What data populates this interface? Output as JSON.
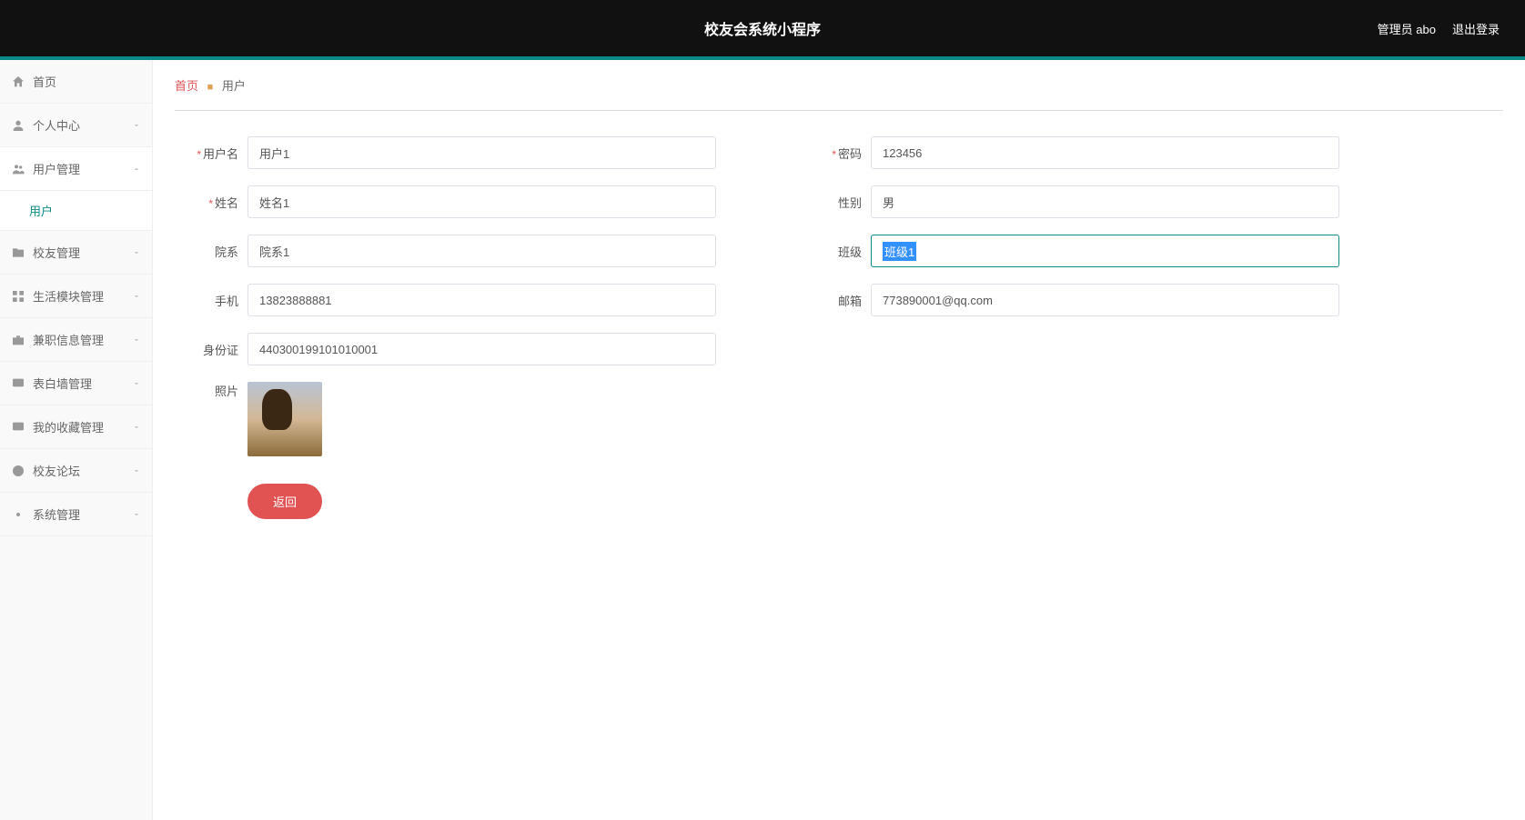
{
  "header": {
    "title": "校友会系统小程序",
    "admin": "管理员 abo",
    "logout": "退出登录"
  },
  "sidebar": {
    "items": [
      {
        "label": "首页",
        "icon": "home"
      },
      {
        "label": "个人中心",
        "icon": "user",
        "chev": true
      },
      {
        "label": "用户管理",
        "icon": "users",
        "chev": true,
        "expanded": true,
        "children": [
          {
            "label": "用户"
          }
        ]
      },
      {
        "label": "校友管理",
        "icon": "folder",
        "chev": true
      },
      {
        "label": "生活模块管理",
        "icon": "grid",
        "chev": true
      },
      {
        "label": "兼职信息管理",
        "icon": "briefcase",
        "chev": true
      },
      {
        "label": "表白墙管理",
        "icon": "message",
        "chev": true
      },
      {
        "label": "我的收藏管理",
        "icon": "star",
        "chev": true
      },
      {
        "label": "校友论坛",
        "icon": "chat",
        "chev": true
      },
      {
        "label": "系统管理",
        "icon": "gear",
        "chev": true
      }
    ]
  },
  "breadcrumb": {
    "home": "首页",
    "sep": "■",
    "current": "用户"
  },
  "form": {
    "username": {
      "label": "用户名",
      "value": "用户1",
      "required": true
    },
    "password": {
      "label": "密码",
      "value": "123456",
      "required": true
    },
    "name": {
      "label": "姓名",
      "value": "姓名1",
      "required": true
    },
    "gender": {
      "label": "性别",
      "value": "男"
    },
    "department": {
      "label": "院系",
      "value": "院系1"
    },
    "classno": {
      "label": "班级",
      "value": "班级1"
    },
    "phone": {
      "label": "手机",
      "value": "13823888881"
    },
    "email": {
      "label": "邮箱",
      "value": "773890001@qq.com"
    },
    "idcard": {
      "label": "身份证",
      "value": "440300199101010001"
    },
    "photo": {
      "label": "照片"
    }
  },
  "buttons": {
    "return": "返回"
  }
}
